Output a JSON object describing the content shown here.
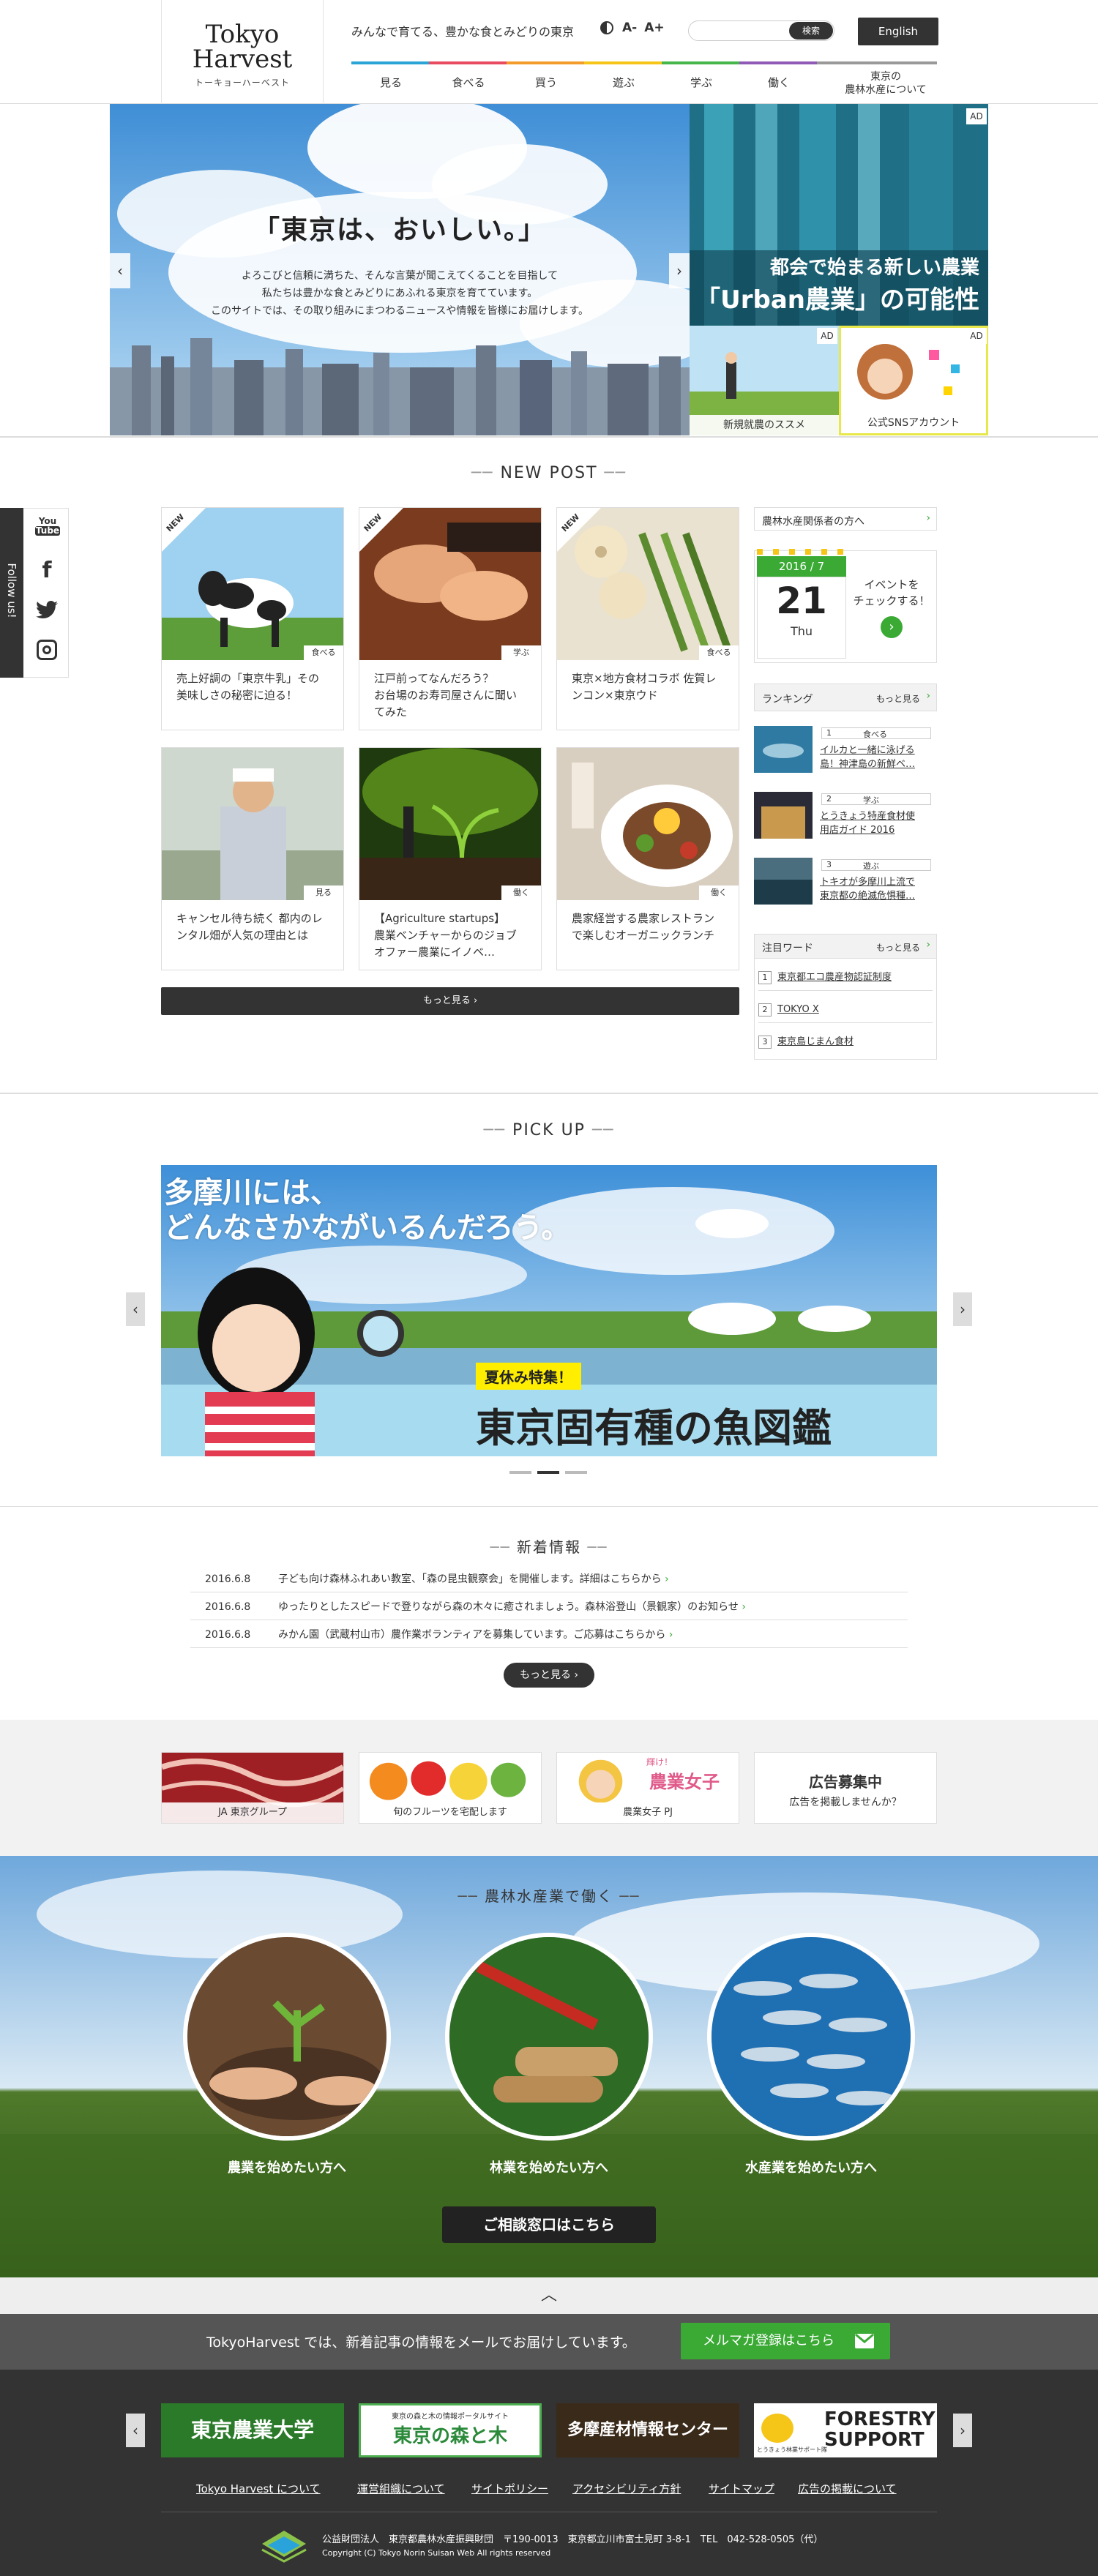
{
  "header": {
    "logo_line1": "Tokyo",
    "logo_line2": "Harvest",
    "logo_kana": "トーキョーハーベスト",
    "tagline": "みんなで育てる、豊かな食とみどりの東京",
    "font_small": "A-",
    "font_large": "A+",
    "search_placeholder": "",
    "search_button": "検索",
    "english": "English",
    "nav": [
      {
        "label": "見る",
        "color": "#2aa3d6"
      },
      {
        "label": "食べる",
        "color": "#e84a5f"
      },
      {
        "label": "買う",
        "color": "#f39c2c"
      },
      {
        "label": "遊ぶ",
        "color": "#f5c518"
      },
      {
        "label": "学ぶ",
        "color": "#45b649"
      },
      {
        "label": "働く",
        "color": "#8e5ab5"
      },
      {
        "label_line1": "東京の",
        "label_line2": "農林水産について",
        "color": "#999999"
      }
    ]
  },
  "hero": {
    "title": "「東京は、おいしい。」",
    "text_line1": "よろこびと信頼に満ちた、そんな言葉が聞こえてくることを目指して",
    "text_line2": "私たちは豊かな食とみどりにあふれる東京を育てています。",
    "text_line3": "このサイトでは、その取り組みにまつわるニュースや情報を皆様にお届けします。",
    "prev": "‹",
    "next": "›"
  },
  "ads": {
    "tag": "AD",
    "main_line1": "都会で始まる新しい農業",
    "main_line2": "「Urban農業」の可能性",
    "sub1_caption": "新規就農のススメ",
    "sub2_caption": "公式SNSアカウント"
  },
  "follow": {
    "label": "Follow us!",
    "youtube_line1": "You",
    "youtube_line2": "Tube",
    "icons": [
      "youtube-icon",
      "facebook-icon",
      "twitter-icon",
      "instagram-icon"
    ]
  },
  "new_post": {
    "title": "NEW POST",
    "new_badge": "NEW",
    "more": "もっと見る",
    "cards": [
      {
        "line1": "売上好調の「東京牛乳」その",
        "line2": "美味しさの秘密に迫る！",
        "line3": "",
        "cat": "食べる",
        "is_new": true
      },
      {
        "line1": "江戸前ってなんだろう？",
        "line2": "お台場のお寿司屋さんに聞い",
        "line3": "てみた",
        "cat": "学ぶ",
        "is_new": true
      },
      {
        "line1": "東京×地方食材コラボ 佐賀レ",
        "line2": "ンコン×東京ウド",
        "line3": "",
        "cat": "食べる",
        "is_new": true
      },
      {
        "line1": "キャンセル待ち続く 都内のレ",
        "line2": "ンタル畑が人気の理由とは",
        "line3": "",
        "cat": "見る",
        "is_new": false
      },
      {
        "line1": "【Agriculture startups】",
        "line2": "農業ベンチャーからのジョブ",
        "line3": "オファー農業にイノベ…",
        "cat": "働く",
        "is_new": false
      },
      {
        "line1": "農家経営する農家レストラン",
        "line2": "で楽しむオーガニックランチ",
        "line3": "",
        "cat": "働く",
        "is_new": false
      }
    ]
  },
  "sidebar": {
    "for_professionals": "農林水産関係者の方へ",
    "calendar_month": "2016 / 7",
    "calendar_day": "21",
    "calendar_weekday": "Thu",
    "event_line1": "イベントを",
    "event_line2": "チェックする！",
    "ranking_title": "ランキング",
    "ranking_more": "もっと見る",
    "ranking": [
      {
        "rank": "1",
        "cat": "食べる",
        "line1": "イルカと一緒に泳げる",
        "line2": "島！神津島の新鮮ベ…"
      },
      {
        "rank": "2",
        "cat": "学ぶ",
        "line1": "とうきょう特産食材使",
        "line2": "用店ガイド 2016"
      },
      {
        "rank": "3",
        "cat": "遊ぶ",
        "line1": "トキオが多摩川上流で",
        "line2": "東京都の絶滅危惧種…"
      }
    ],
    "keywords_title": "注目ワード",
    "keywords_more": "もっと見る",
    "keywords": [
      {
        "num": "1",
        "word": "東京都エコ農産物認証制度"
      },
      {
        "num": "2",
        "word": "TOKYO X"
      },
      {
        "num": "3",
        "word": "東京島じまん食材"
      }
    ]
  },
  "pickup": {
    "title": "PICK UP",
    "headline_line1": "多摩川には、",
    "headline_line2": "どんなさかながいるんだろう。",
    "tag": "夏休み特集！",
    "subtitle": "東京固有種の魚図鑑",
    "prev": "‹",
    "next": "›"
  },
  "news": {
    "title": "新着情報",
    "more": "もっと見る",
    "items": [
      {
        "date": "2016.6.8",
        "text": "子ども向け森林ふれあい教室、「森の昆虫観察会」を開催します。詳細はこちらから"
      },
      {
        "date": "2016.6.8",
        "text": "ゆったりとしたスピードで登りながら森の木々に癒されましょう。森林浴登山（景観家）のお知らせ"
      },
      {
        "date": "2016.6.8",
        "text": "みかん園（武蔵村山市）農作業ボランティアを募集しています。ご応募はこちらから"
      }
    ]
  },
  "banners": [
    {
      "label": "JA 東京グループ"
    },
    {
      "label": "旬のフルーツを宅配します"
    },
    {
      "label": "農業女子 PJ",
      "overlay_small": "輝け！",
      "overlay_big": "農業女子"
    },
    {
      "title": "広告募集中",
      "sub": "広告を掲載しませんか？"
    }
  ],
  "work": {
    "title": "農林水産業で働く",
    "items": [
      {
        "label": "農業を始めたい方へ"
      },
      {
        "label": "林業を始めたい方へ"
      },
      {
        "label": "水産業を始めたい方へ"
      }
    ],
    "consult": "ご相談窓口はこちら"
  },
  "to_top": "︿",
  "mail": {
    "text": "TokyoHarvest では、新着記事の情報をメールでお届けしています。",
    "button": "メルマガ登録はこちら"
  },
  "footer": {
    "banners": [
      {
        "text": "東京農業大学"
      },
      {
        "small": "東京の森と木の情報ポータルサイト",
        "text": "東京の森と木"
      },
      {
        "text": "多摩産材情報センター"
      },
      {
        "small": "とうきょう林業サポート隊",
        "text_line1": "FORESTRY",
        "text_line2": "SUPPORT"
      }
    ],
    "links": [
      "Tokyo Harvest について",
      "運営組織について",
      "サイトポリシー",
      "アクセシビリティ方針",
      "サイトマップ",
      "広告の掲載について"
    ],
    "corp": "公益財団法人　東京都農林水産振興財団　〒190-0013　東京都立川市富士見町 3-8-1　TEL　042-528-0505（代）",
    "copyright": "Copyright (C) Tokyo Norin Suisan Web All rights reserved"
  },
  "colors": {
    "accent_green": "#3aaa35",
    "dark": "#333333",
    "footer_bg": "#333333"
  }
}
